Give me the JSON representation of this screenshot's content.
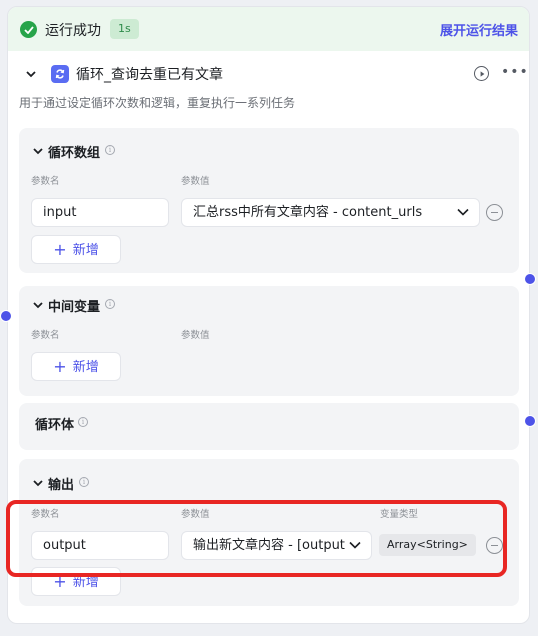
{
  "status": {
    "text": "运行成功",
    "duration": "1s",
    "expand_link": "展开运行结果",
    "success_color": "#27a44a"
  },
  "node": {
    "title": "循环_查询去重已有文章",
    "description": "用于通过设定循环次数和逻辑，重复执行一系列任务",
    "icon": "loop-icon",
    "accent_color": "#4d53e8"
  },
  "loop_array": {
    "title": "循环数组",
    "col_name": "参数名",
    "col_value": "参数值",
    "param_name": "input",
    "param_value": "汇总rss中所有文章内容 - content_urls",
    "add_label": "新增"
  },
  "intermediate": {
    "title": "中间变量",
    "col_name": "参数名",
    "col_value": "参数值",
    "add_label": "新增"
  },
  "loop_body": {
    "title": "循环体"
  },
  "output": {
    "title": "输出",
    "col_name": "参数名",
    "col_value": "参数值",
    "col_type": "变量类型",
    "param_name": "output",
    "param_value": "输出新文章内容 - [output",
    "type": "Array<String>",
    "add_label": "新增"
  },
  "annotation": {
    "highlight_color": "#e82623"
  }
}
